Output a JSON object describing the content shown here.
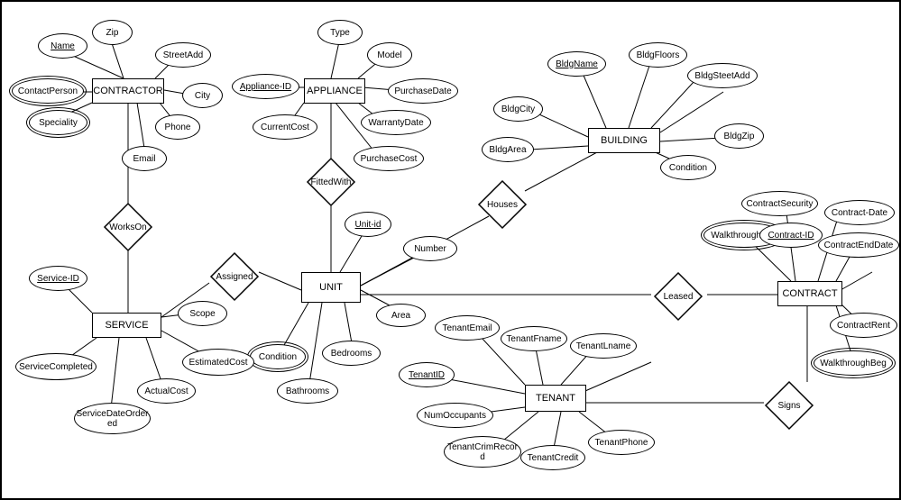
{
  "entities": {
    "contractor": "CONTRACTOR",
    "appliance": "APPLIANCE",
    "building": "BUILDING",
    "unit": "UNIT",
    "service": "SERVICE",
    "tenant": "TENANT",
    "contract": "CONTRACT"
  },
  "relationships": {
    "worksOn": "WorksOn",
    "fittedWith": "FittedWith",
    "houses": "Houses",
    "assigned": "Assigned",
    "leased": "Leased",
    "signs": "Signs"
  },
  "attrs": {
    "contractor_name": "Name",
    "contractor_zip": "Zip",
    "contractor_streetAdd": "StreetAdd",
    "contractor_city": "City",
    "contractor_phone": "Phone",
    "contractor_email": "Email",
    "contractor_contactPerson": "ContactPerson",
    "contractor_speciality": "Speciality",
    "appliance_type": "Type",
    "appliance_model": "Model",
    "appliance_purchaseDate": "PurchaseDate",
    "appliance_warrantyDate": "WarrantyDate",
    "appliance_id": "Appliance-ID",
    "appliance_currentCost": "CurrentCost",
    "appliance_purchaseCost": "PurchaseCost",
    "building_bldgName": "BldgName",
    "building_bldgFloors": "BldgFloors",
    "building_bldgSteetAdd": "BldgSteetAdd",
    "building_bldgZip": "BldgZip",
    "building_condition": "Condition",
    "building_bldgCity": "BldgCity",
    "building_bldgArea": "BldgArea",
    "unit_id": "Unit-id",
    "unit_number": "Number",
    "unit_area": "Area",
    "unit_bedrooms": "Bedrooms",
    "unit_bathrooms": "Bathrooms",
    "unit_condition": "Condition",
    "service_id": "Service-ID",
    "service_scope": "Scope",
    "service_estimatedCost": "EstimatedCost",
    "service_actualCost": "ActualCost",
    "service_completed": "ServiceCompleted",
    "service_dateOrdered": "ServiceDateOrdered",
    "tenant_id": "TenantID",
    "tenant_email": "TenantEmail",
    "tenant_fname": "TenantFname",
    "tenant_lname": "TenantLname",
    "tenant_phone": "TenantPhone",
    "tenant_credit": "TenantCredit",
    "tenant_crimRecord": "TenantCrimRecord",
    "tenant_numOccupants": "NumOccupants",
    "contract_id": "Contract-ID",
    "contract_security": "ContractSecurity",
    "contract_date": "Contract-Date",
    "contract_endDate": "ContractEndDate",
    "contract_rent": "ContractRent",
    "contract_walkBeg": "WalkthroughBeg",
    "contract_walkEnd": "WalkthroughEnd"
  }
}
